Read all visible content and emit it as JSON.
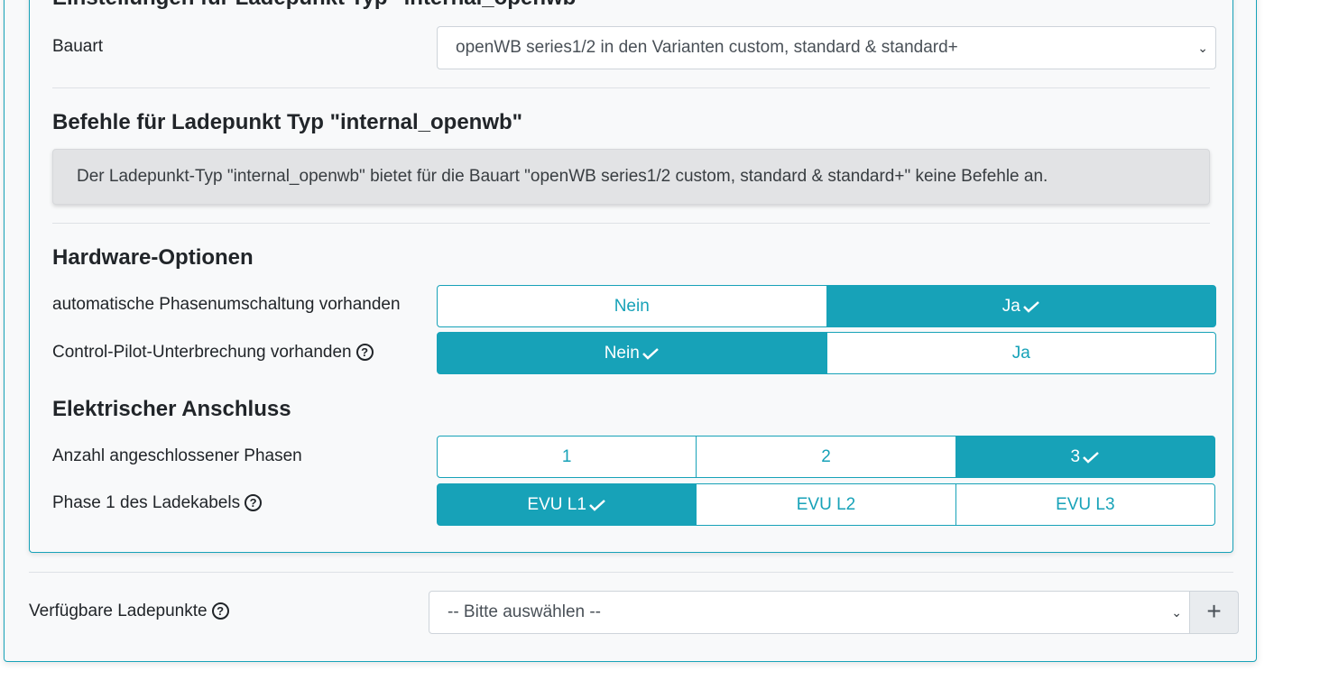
{
  "settings_section": {
    "heading": "Einstellungen für Ladepunkt Typ \"internal_openwb\"",
    "bauart_label": "Bauart",
    "bauart_value": "openWB series1/2 in den Varianten custom, standard & standard+"
  },
  "commands_section": {
    "heading": "Befehle für Ladepunkt Typ \"internal_openwb\"",
    "message": "Der Ladepunkt-Typ \"internal_openwb\" bietet für die Bauart \"openWB series1/2 custom, standard & standard+\" keine Befehle an."
  },
  "hardware_section": {
    "heading": "Hardware-Optionen",
    "phase_switch": {
      "label": "automatische Phasenumschaltung vorhanden",
      "options": [
        "Nein",
        "Ja"
      ],
      "selected": "Ja"
    },
    "cp_interrupt": {
      "label": "Control-Pilot-Unterbrechung vorhanden",
      "options": [
        "Nein",
        "Ja"
      ],
      "selected": "Nein"
    }
  },
  "electrical_section": {
    "heading": "Elektrischer Anschluss",
    "phases": {
      "label": "Anzahl angeschlossener Phasen",
      "options": [
        "1",
        "2",
        "3"
      ],
      "selected": "3"
    },
    "phase1": {
      "label": "Phase 1 des Ladekabels",
      "options": [
        "EVU L1",
        "EVU L2",
        "EVU L3"
      ],
      "selected": "EVU L1"
    }
  },
  "available": {
    "label": "Verfügbare Ladepunkte",
    "select_value": "-- Bitte auswählen --",
    "add_symbol": "+"
  },
  "icons": {
    "help": "question-circle-icon",
    "check": "check-icon",
    "dropdown": "chevron-down-icon",
    "add": "plus-icon"
  },
  "colors": {
    "accent": "#17a2b8",
    "card_bg": "#f8f9fa",
    "alert_bg": "#e2e3e5"
  }
}
